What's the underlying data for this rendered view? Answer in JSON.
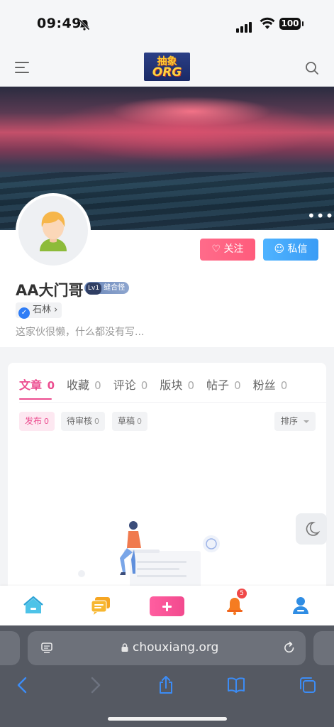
{
  "status_bar": {
    "time": "09:49",
    "battery": "100"
  },
  "header": {
    "logo_text": "抽象",
    "logo_sub": "ORG"
  },
  "profile": {
    "username": "AA大门哥",
    "level_prefix": "Lv1",
    "level_title": "缝合怪",
    "location_tag": "石林",
    "bio": "这家伙很懒，什么都没有写...",
    "follow_label": "关注",
    "message_label": "私信"
  },
  "tabs": [
    {
      "label": "文章",
      "count": "0",
      "active": true
    },
    {
      "label": "收藏",
      "count": "0"
    },
    {
      "label": "评论",
      "count": "0"
    },
    {
      "label": "版块",
      "count": "0"
    },
    {
      "label": "帖子",
      "count": "0"
    },
    {
      "label": "粉丝",
      "count": "0"
    }
  ],
  "filters": [
    {
      "label": "发布",
      "count": "0",
      "active": true
    },
    {
      "label": "待审核",
      "count": "0"
    },
    {
      "label": "草稿",
      "count": "0"
    }
  ],
  "sort_label": "排序",
  "bottom_nav": {
    "notification_badge": "5",
    "items": [
      "home-icon",
      "chat-icon",
      "add-icon",
      "bell-icon",
      "user-icon"
    ]
  },
  "browser": {
    "url": "chouxiang.org"
  },
  "colors": {
    "accent": "#ec4c8f",
    "follow": "#ff5c7c",
    "message": "#3a9cf5"
  }
}
